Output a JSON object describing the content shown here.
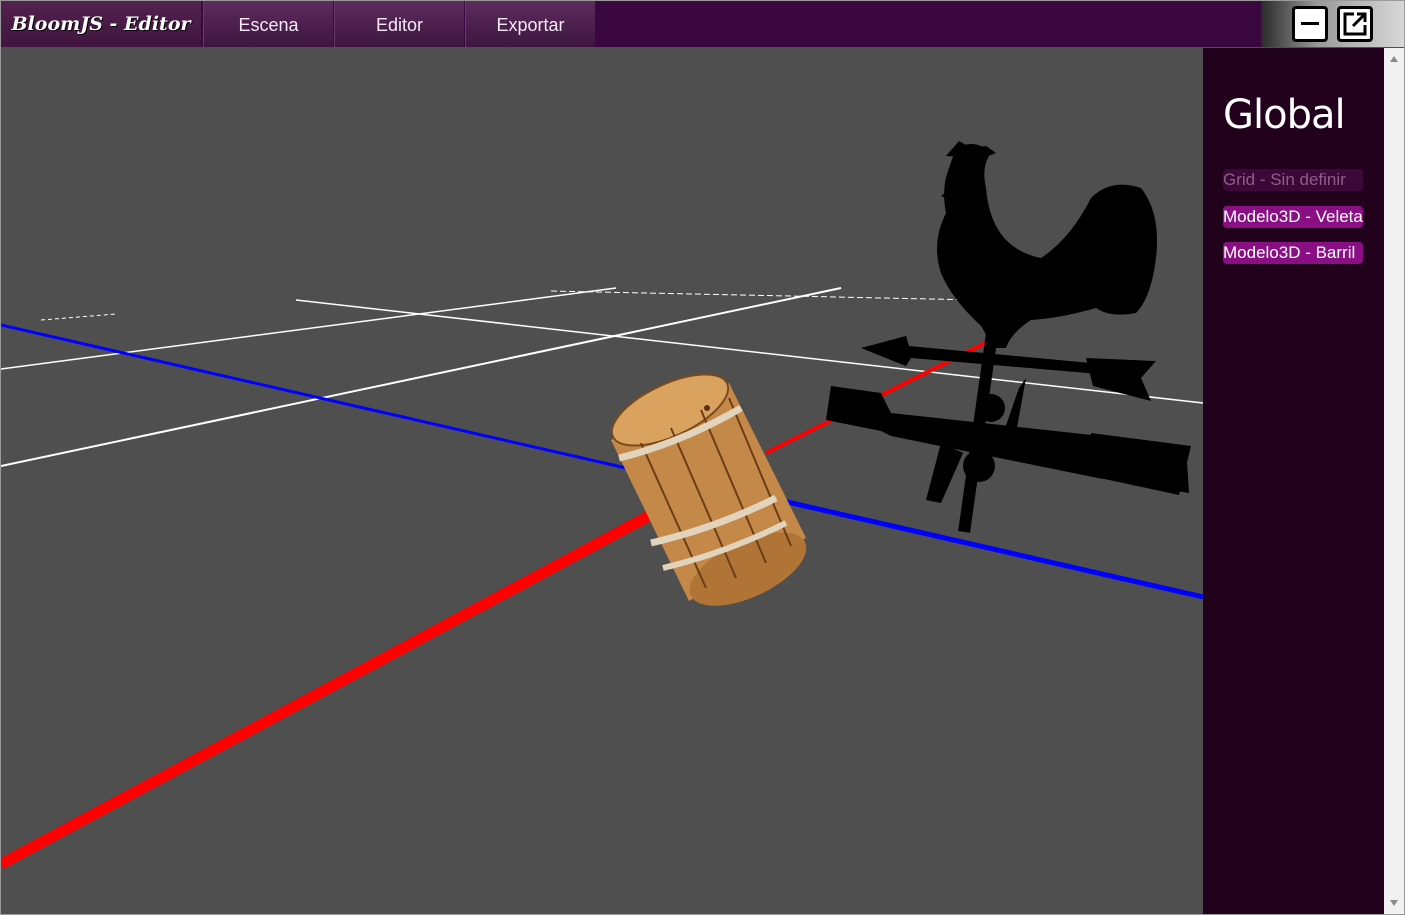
{
  "app": {
    "brand": "BloomJS - Editor"
  },
  "menu": {
    "tabs": [
      "Escena",
      "Editor",
      "Exportar"
    ]
  },
  "window_controls": {
    "icons": [
      "minimize-icon",
      "popout-icon"
    ]
  },
  "panel": {
    "title": "Global",
    "items": [
      {
        "label": "Grid - Sin definir",
        "state": "disabled"
      },
      {
        "label": "Modelo3D - Veleta",
        "state": "active"
      },
      {
        "label": "Modelo3D - Barril",
        "state": "active"
      }
    ]
  },
  "scene": {
    "background": "#4f4f4f",
    "axis_x_color": "#ff0000",
    "axis_z_color": "#0000ff",
    "grid_color": "#ffffff",
    "objects": [
      "barrel",
      "weathervane-rooster"
    ]
  },
  "colors": {
    "topbar": "#3a0740",
    "panel": "#22011d",
    "item": "#8a0f84"
  }
}
